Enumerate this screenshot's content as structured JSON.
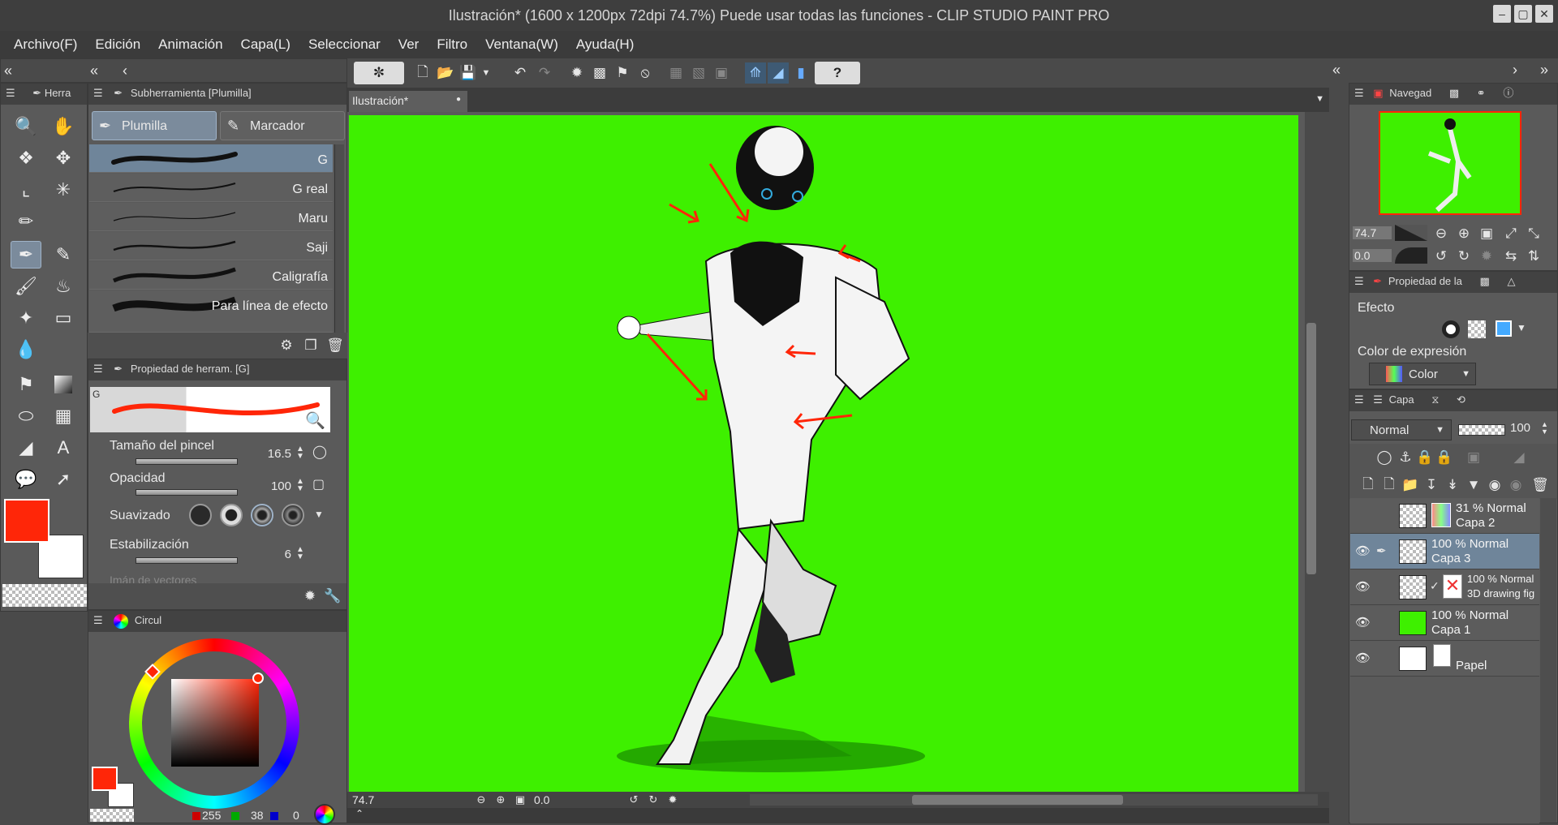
{
  "window": {
    "title": "Ilustración* (1600 x 1200px 72dpi 74.7%)  Puede usar todas las funciones - CLIP STUDIO PAINT PRO"
  },
  "menu": [
    "Archivo(F)",
    "Edición",
    "Animación",
    "Capa(L)",
    "Seleccionar",
    "Ver",
    "Filtro",
    "Ventana(W)",
    "Ayuda(H)"
  ],
  "tools_panel": {
    "tab": "Herra"
  },
  "subtool": {
    "header": "Subherramienta [Plumilla]",
    "tabs": [
      "Plumilla",
      "Marcador"
    ],
    "brushes": [
      "G",
      "G real",
      "Maru",
      "Saji",
      "Caligrafía",
      "Para línea de efecto"
    ]
  },
  "tool_property": {
    "header": "Propiedad de herram. [G]",
    "preview_label": "G",
    "brush_size": {
      "label": "Tamaño del pincel",
      "value": "16.5"
    },
    "opacity": {
      "label": "Opacidad",
      "value": "100"
    },
    "smoothing": {
      "label": "Suavizado"
    },
    "stabilization": {
      "label": "Estabilización",
      "value": "6"
    },
    "vector_magnet": "Imán de vectores"
  },
  "colors": {
    "main": "#ff2608",
    "sub": "#ffffff",
    "canvas_bg": "#3ef000",
    "accent": "#ff2608"
  },
  "color_panel": {
    "tab": "Circul",
    "r": "255",
    "g": "38",
    "b": "0"
  },
  "document": {
    "tab": "Ilustración*",
    "zoom": "74.7",
    "rotation": "0.0"
  },
  "navigator": {
    "tab": "Navegad",
    "zoom": "74.7",
    "rotation": "0.0"
  },
  "layer_property": {
    "tab": "Propiedad de la",
    "effect_label": "Efecto",
    "expression_label": "Color de expresión",
    "expression_value": "Color"
  },
  "layers_panel": {
    "tab": "Capa",
    "blend": "Normal",
    "opacity": "100",
    "layers": [
      {
        "line1": "31 % Normal",
        "line2": "Capa 2",
        "visible": false
      },
      {
        "line1": "100 % Normal",
        "line2": "Capa 3",
        "visible": true
      },
      {
        "line1": "100 % Normal",
        "line2": "3D drawing fig",
        "visible": true
      },
      {
        "line1": "100 % Normal",
        "line2": "Capa 1",
        "visible": true
      },
      {
        "line1": "",
        "line2": "Papel",
        "visible": true
      }
    ]
  }
}
